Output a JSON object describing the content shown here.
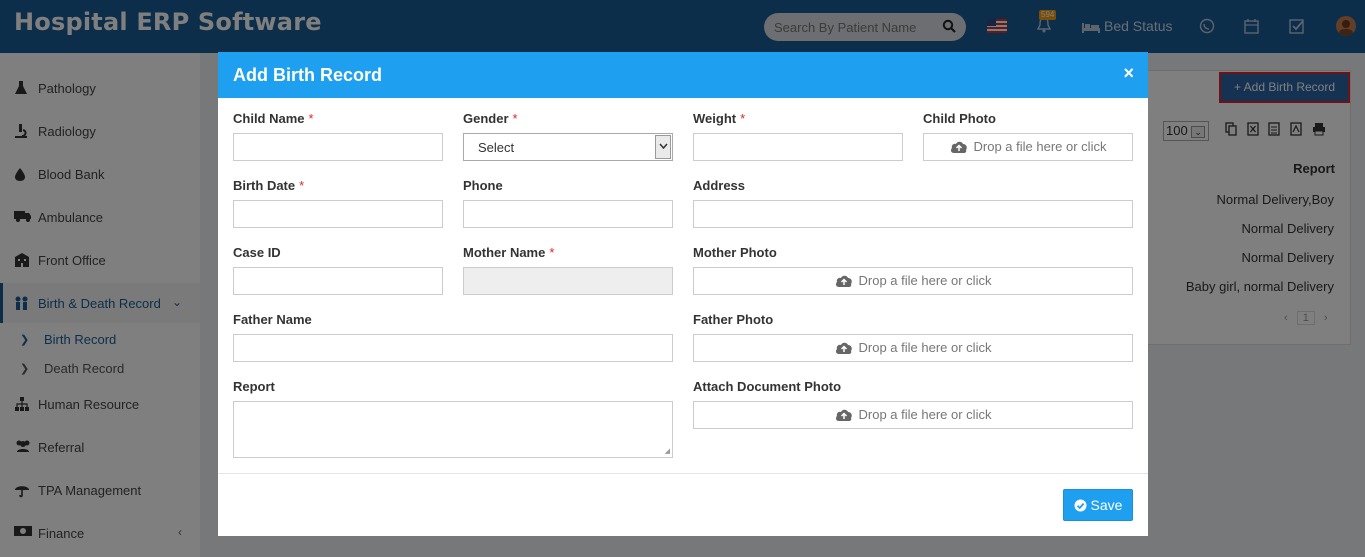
{
  "app": {
    "title": "Hospital ERP Software"
  },
  "header": {
    "search_placeholder": "Search By Patient Name",
    "notification_count": "594",
    "bed_status_label": "Bed Status"
  },
  "sidebar": {
    "items": [
      {
        "label": "Pathology",
        "icon": "flask-icon"
      },
      {
        "label": "Radiology",
        "icon": "microscope-icon"
      },
      {
        "label": "Blood Bank",
        "icon": "drop-icon"
      },
      {
        "label": "Ambulance",
        "icon": "ambulance-icon"
      },
      {
        "label": "Front Office",
        "icon": "building-icon"
      },
      {
        "label": "Birth & Death Record",
        "icon": "family-icon"
      },
      {
        "label": "Human Resource",
        "icon": "sitemap-icon"
      },
      {
        "label": "Referral",
        "icon": "users-icon"
      },
      {
        "label": "TPA Management",
        "icon": "umbrella-icon"
      },
      {
        "label": "Finance",
        "icon": "money-icon"
      }
    ],
    "sub_items": [
      {
        "label": "Birth Record"
      },
      {
        "label": "Death Record"
      }
    ]
  },
  "background": {
    "add_button": "+ Add Birth Record",
    "rows_per_page": "100",
    "report_header": "Report",
    "report_rows": [
      "Normal Delivery,Boy",
      "Normal Delivery",
      "Normal Delivery",
      "Baby girl, normal Delivery"
    ],
    "page_number": "1"
  },
  "modal": {
    "title": "Add Birth Record",
    "close": "×",
    "fields": {
      "child_name": "Child Name",
      "gender": "Gender",
      "gender_value": "Select",
      "weight": "Weight",
      "child_photo": "Child Photo",
      "birth_date": "Birth Date",
      "phone": "Phone",
      "address": "Address",
      "case_id": "Case ID",
      "mother_name": "Mother Name",
      "mother_photo": "Mother Photo",
      "father_name": "Father Name",
      "father_photo": "Father Photo",
      "report": "Report",
      "attach_document_photo": "Attach Document Photo"
    },
    "required_mark": "*",
    "drop_text": "Drop a file here or click",
    "save": "Save"
  },
  "colors": {
    "header": "#1a5c95",
    "modal_header": "#1f9ff0",
    "required": "#e0232b"
  }
}
